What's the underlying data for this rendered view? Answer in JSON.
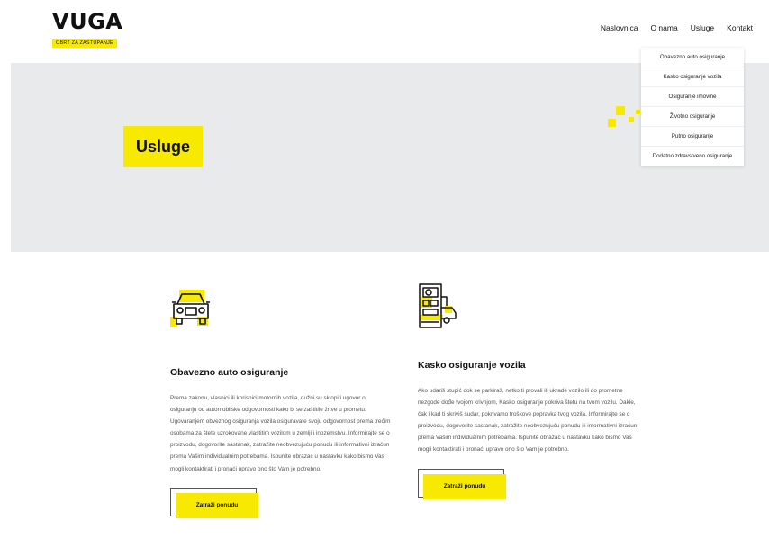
{
  "brand": {
    "name": "VUGA",
    "tagline": "OBRT ZA ZASTUPANJE"
  },
  "nav": {
    "items": [
      {
        "label": "Naslovnica"
      },
      {
        "label": "O nama"
      },
      {
        "label": "Usluge"
      },
      {
        "label": "Kontakt"
      }
    ]
  },
  "dropdown": {
    "items": [
      "Obavezno auto osiguranje",
      "Kasko osiguranje vozila",
      "Osiguranje imovine",
      "Životno osiguranje",
      "Putno osiguranje",
      "Dodatno zdravstveno osiguranje"
    ]
  },
  "hero": {
    "title": "Usluge"
  },
  "cards": [
    {
      "title": "Obavezno auto osiguranje",
      "icon": "car-front-icon",
      "text": "Prema zakonu, vlasnici ili korisnici motornih vozila, dužni su sklopiti ugovor o osiguranju od automobilske odgovornosti kako bi se zaštitile žrtve u prometu. Ugovaranjem obveznog osiguranja vozila osiguravate svoju odgovornost prema trećim osobama za štete uzrokovane vlastitim vozilom u zemlji i inozemstvu. Informirajte se o proizvodu, dogovorite sastanak, zatražite neobvezujuću ponudu ili informativni izračun prema Vašim individualnim potrebama. Ispunite obrazac u nastavku kako bismo Vas mogli kontaktirati i pronaći upravo ono što Vam je potrebno.",
      "button": "Zatraži ponudu"
    },
    {
      "title": "Kasko osiguranje vozila",
      "icon": "fuel-pump-car-icon",
      "text": "Ako udariš stupić dok se parkiraš, netko ti provali ili ukrade vozilo ili do prometne nezgode dođe tvojom krivnjom, Kasko osiguranje pokriva štetu na tvom vozilu. Dakle, čak i kad ti skriviš sudar, pokrivamo troškove popravka tvog vozila. Informirajte se o proizvodu, dogovorite sastanak, zatražite neobvezujuću ponudu ili informativni izračun prema Vašim individualnim potrebama. Ispunite obrazac u nastavku kako bismo Vas mogli kontaktirati i pronaći upravo ono što Vam je potrebno.",
      "button": "Zatraži ponudu"
    }
  ],
  "colors": {
    "accent": "#f7ea00",
    "hero_bg": "#e8eaeb",
    "text": "#222222"
  }
}
